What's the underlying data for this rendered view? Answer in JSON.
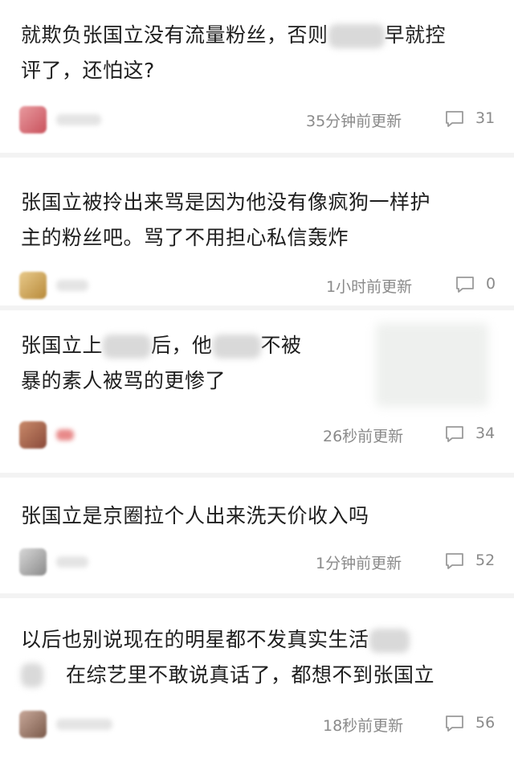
{
  "posts": [
    {
      "text_a": "就欺负张国立没有流量粉丝，否则",
      "text_b": "早就控",
      "text_line2": "评了，还怕这?",
      "time": "35分钟前更新",
      "comment_count": "31"
    },
    {
      "text_line1": "张国立被拎出来骂是因为他没有像疯狗一样护",
      "text_line2": "主的粉丝吧。骂了不用担心私信轰炸",
      "time": "1小时前更新",
      "comment_count": "0"
    },
    {
      "text_a": "张国立上",
      "text_b": "后，他",
      "text_c": "不被",
      "text_line2": "暴的素人被骂的更惨了",
      "time": "26秒前更新",
      "comment_count": "34"
    },
    {
      "text_line1": "张国立是京圈拉个人出来洗天价收入吗",
      "time": "1分钟前更新",
      "comment_count": "52"
    },
    {
      "text_a": "以后也别说现在的明星都不发真实生活",
      "text_line2": "在综艺里不敢说真话了，都想不到张国立",
      "time": "18秒前更新",
      "comment_count": "56"
    }
  ],
  "colors": {
    "meta_text": "#8a8a8a",
    "divider": "#f3f3f3",
    "text": "#1e1e1e"
  },
  "icons": {
    "comment": "speech-bubble-icon"
  }
}
